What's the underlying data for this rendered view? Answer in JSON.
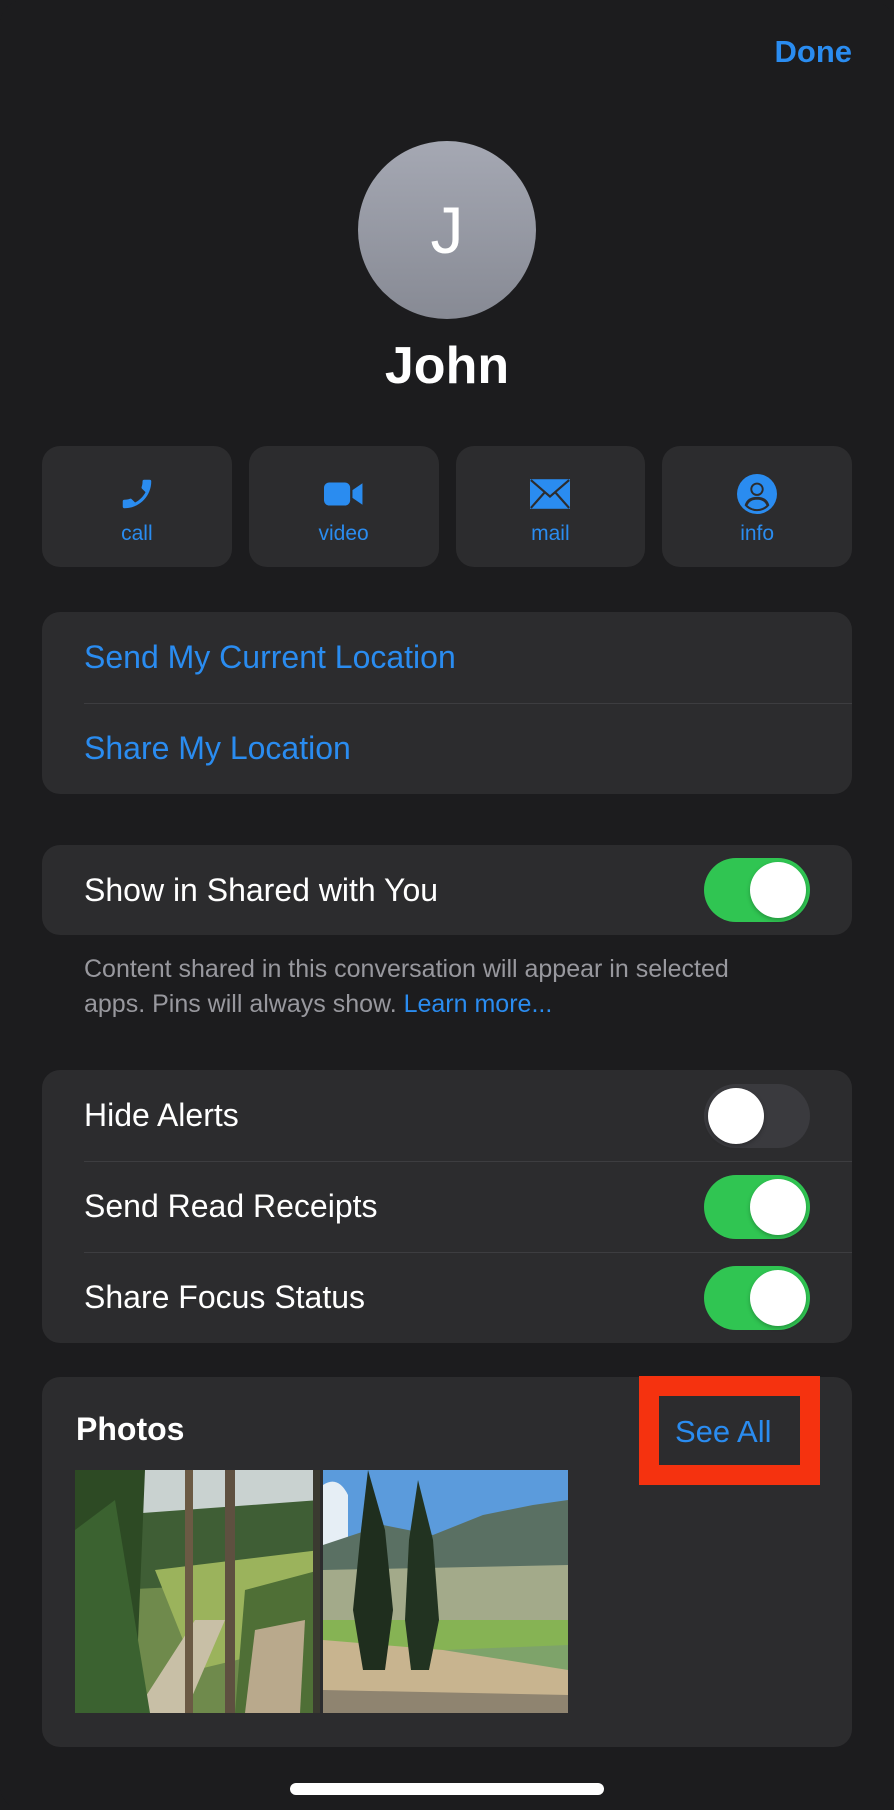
{
  "header": {
    "done_label": "Done"
  },
  "contact": {
    "initial": "J",
    "name": "John"
  },
  "actions": [
    {
      "label": "call",
      "icon": "phone-icon"
    },
    {
      "label": "video",
      "icon": "video-camera-icon"
    },
    {
      "label": "mail",
      "icon": "envelope-icon"
    },
    {
      "label": "info",
      "icon": "person-circle-icon"
    }
  ],
  "location": {
    "send_current": "Send My Current Location",
    "share": "Share My Location"
  },
  "shared_with_you": {
    "label": "Show in Shared with You",
    "enabled": true,
    "footnote": "Content shared in this conversation will appear in selected apps. Pins will always show.",
    "learn_more": "Learn more..."
  },
  "settings": [
    {
      "label": "Hide Alerts",
      "enabled": false
    },
    {
      "label": "Send Read Receipts",
      "enabled": true
    },
    {
      "label": "Share Focus Status",
      "enabled": true
    }
  ],
  "photos": {
    "title": "Photos",
    "see_all": "See All",
    "items": [
      {
        "description": "Forest hillside with tall pine trees and dirt path"
      },
      {
        "description": "Pine trees in front of mountains with blue sky and dirt trail"
      }
    ]
  },
  "colors": {
    "accent": "#2a8cf0",
    "toggle_on": "#30c552",
    "highlight": "#f5320f",
    "background": "#1c1c1e",
    "card": "#2c2c2e"
  }
}
